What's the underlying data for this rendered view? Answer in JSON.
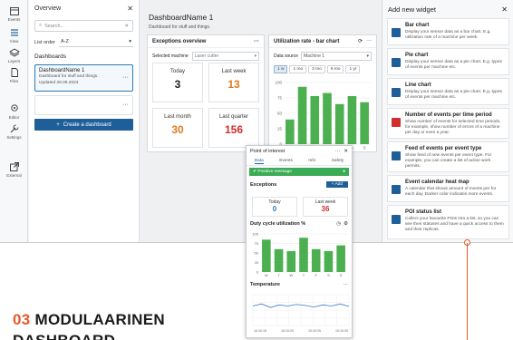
{
  "rail": {
    "items": [
      {
        "label": "Events",
        "icon": "calendar-icon"
      },
      {
        "label": "View",
        "icon": "list-icon"
      },
      {
        "label": "Layers",
        "icon": "layers-icon"
      },
      {
        "label": "Files",
        "icon": "file-icon"
      },
      {
        "label": "Editor",
        "icon": "location-pin-icon"
      },
      {
        "label": "Settings",
        "icon": "wrench-icon"
      },
      {
        "label": "External",
        "icon": "external-link-icon"
      }
    ]
  },
  "overview": {
    "title": "Overview",
    "search_placeholder": "Search...",
    "list_order_label": "List order",
    "list_order_value": "A-Z",
    "section": "Dashboards",
    "dashboard": {
      "name": "DashboardName 1",
      "desc": "Dashboard for stuff and things.",
      "updated": "Updated 29.09.2023"
    },
    "create_label": "Create a dashboard"
  },
  "main": {
    "title": "DashboardName 1",
    "subtitle": "Dashboard for stuff and things.",
    "exceptions": {
      "title": "Exceptions overview",
      "machine_label": "Selected machine",
      "machine_value": "Laser cutter",
      "stats": [
        {
          "label": "Today",
          "value": "3",
          "color": "#222222"
        },
        {
          "label": "Last week",
          "value": "13",
          "color": "#e07a1f"
        },
        {
          "label": "Last month",
          "value": "30",
          "color": "#e07a1f"
        },
        {
          "label": "Last quarter",
          "value": "156",
          "color": "#d12e2e"
        }
      ]
    },
    "utilization": {
      "title": "Utilization rate - bar chart",
      "source_label": "Data source",
      "source_value": "Machine 1",
      "ranges": [
        "1 w",
        "1 mo",
        "3 mo",
        "6 mo",
        "1 yr"
      ],
      "active_range": "1 w"
    }
  },
  "chart_data": [
    {
      "type": "bar",
      "categories": [
        "M",
        "T",
        "W",
        "T",
        "F",
        "S",
        "S"
      ],
      "values": [
        40,
        93,
        78,
        83,
        65,
        78,
        68
      ],
      "ylim": [
        0,
        100
      ],
      "yticks": [
        0,
        25,
        50,
        75,
        100
      ],
      "color": "#4caf50"
    },
    {
      "type": "bar",
      "categories": [
        "M",
        "T",
        "W",
        "T",
        "F",
        "S",
        "S"
      ],
      "values": [
        85,
        60,
        55,
        90,
        60,
        55,
        70
      ],
      "ylim": [
        0,
        100
      ],
      "yticks": [
        0,
        25,
        50,
        75,
        100
      ],
      "color": "#4caf50"
    },
    {
      "type": "line",
      "x": [
        "",
        "",
        "",
        ""
      ],
      "values": [
        38,
        42,
        35,
        40,
        38,
        41,
        39,
        36,
        40,
        38,
        42,
        37
      ],
      "color": "#3b7ec8"
    }
  ],
  "drawer": {
    "title": "Add new widget",
    "widgets": [
      {
        "title": "Bar chart",
        "desc": "Display your sensor data as a bar chart. E.g. utilization rate of a machine per week.",
        "icon": "bar-chart-icon",
        "color": "#1f5f99"
      },
      {
        "title": "Pie chart",
        "desc": "Display your sensor data as a pie chart. E.g. types of events per machine etc.",
        "icon": "pie-chart-icon",
        "color": "#1f5f99"
      },
      {
        "title": "Line chart",
        "desc": "Display your sensor data as a pie chart. E.g. types of events per machine etc.",
        "icon": "line-chart-icon",
        "color": "#1f5f99"
      },
      {
        "title": "Number of events per time period",
        "desc": "Show number of events for selected time periods, for example, show number of errors of a machine per day or even a year.",
        "icon": "warning-icon",
        "color": "#d12e2e"
      },
      {
        "title": "Feed of events per event type",
        "desc": "Show feed of new events per event type. For example, you can create a list of active work permits.",
        "icon": "feed-icon",
        "color": "#1f5f99"
      },
      {
        "title": "Event calendar heat map",
        "desc": "A calendar that shows amount of events per for each day. Darker color indicates more events.",
        "icon": "calendar-grid-icon",
        "color": "#1f5f99"
      },
      {
        "title": "POI status list",
        "desc": "Collect your favourite POIs into a list, so you can see their statuses and have a quick access to them and their replicas.",
        "icon": "list-status-icon",
        "color": "#1f5f99"
      }
    ]
  },
  "poi": {
    "title": "Point of interest",
    "tabs": [
      "Data",
      "Events",
      "Info",
      "Safety"
    ],
    "message": "Positive message",
    "exceptions_label": "Exceptions",
    "add_label": "+ Add",
    "stats": [
      {
        "label": "Today",
        "value": "0",
        "color": "#2a7ab8"
      },
      {
        "label": "Last week",
        "value": "36",
        "color": "#d12e2e"
      }
    ],
    "duty_label": "Duty cycle utilization %",
    "temperature_label": "Temperature",
    "time_ticks": [
      "10:10:15",
      "10:10:20",
      "10:10:25",
      "10:10:30"
    ]
  },
  "headline": {
    "number": "03",
    "line1": "MODULAARINEN",
    "line2": "DASHBOARD"
  }
}
